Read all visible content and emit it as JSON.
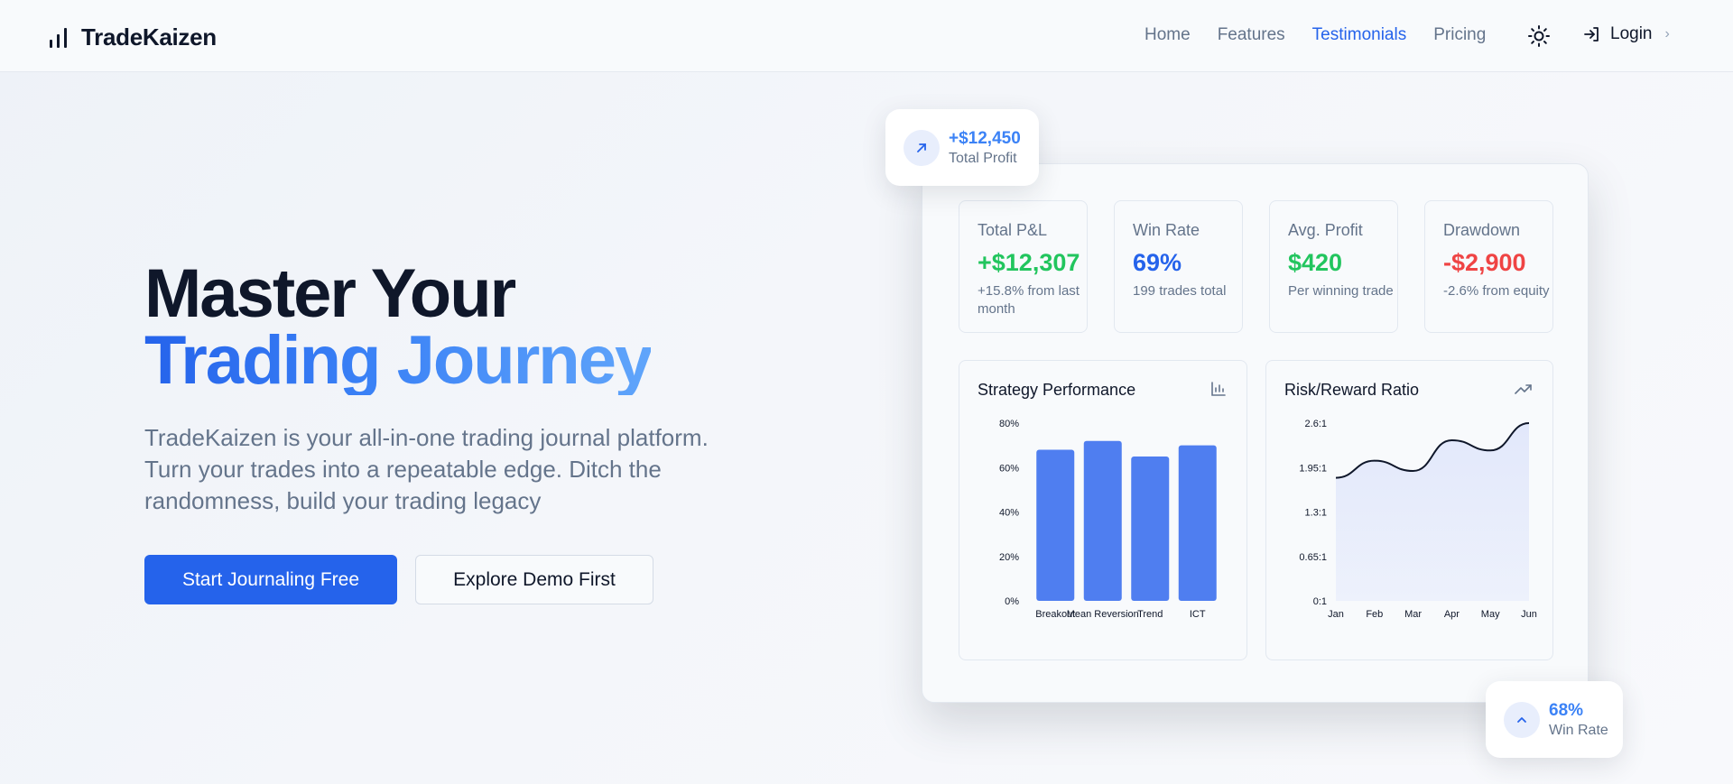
{
  "brand": {
    "name": "TradeKaizen"
  },
  "nav": {
    "items": [
      {
        "label": "Home"
      },
      {
        "label": "Features"
      },
      {
        "label": "Testimonials"
      },
      {
        "label": "Pricing"
      }
    ],
    "active": "Testimonials",
    "login_label": "Login"
  },
  "hero": {
    "title_line1": "Master Your",
    "title_line2": "Trading Journey",
    "subtitle": "TradeKaizen is your all-in-one trading journal platform. Turn your trades into a repeatable edge. Ditch the randomness, build your trading legacy",
    "primary_button": "Start Journaling Free",
    "secondary_button": "Explore Demo First"
  },
  "badges": {
    "profit": {
      "value": "+$12,450",
      "label": "Total Profit"
    },
    "winrate": {
      "value": "68%",
      "label": "Win Rate"
    }
  },
  "stats": [
    {
      "label": "Total P&L",
      "value": "+$12,307",
      "sub": "+15.8% from last month",
      "color": "#22c55e"
    },
    {
      "label": "Win Rate",
      "value": "69%",
      "sub": "199 trades total",
      "color": "#2563eb"
    },
    {
      "label": "Avg. Profit",
      "value": "$420",
      "sub": "Per winning trade",
      "color": "#22c55e"
    },
    {
      "label": "Drawdown",
      "value": "-$2,900",
      "sub": "-2.6% from equity",
      "color": "#ef4444"
    }
  ],
  "chart_data": [
    {
      "type": "bar",
      "title": "Strategy Performance",
      "categories": [
        "Breakout",
        "Mean Reversion",
        "Trend",
        "ICT"
      ],
      "values": [
        68,
        72,
        65,
        70
      ],
      "ylim": [
        0,
        80
      ],
      "yticks": [
        "0%",
        "20%",
        "40%",
        "60%",
        "80%"
      ],
      "grid": false,
      "color": "#4f7ef0"
    },
    {
      "type": "area",
      "title": "Risk/Reward Ratio",
      "categories": [
        "Jan",
        "Feb",
        "Mar",
        "Apr",
        "May",
        "Jun"
      ],
      "values": [
        1.8,
        2.05,
        1.9,
        2.35,
        2.2,
        2.6
      ],
      "ylim": [
        0,
        2.6
      ],
      "yticks": [
        "0:1",
        "0.65:1",
        "1.3:1",
        "1.95:1",
        "2.6:1"
      ],
      "grid": false,
      "line_color": "#0f172a",
      "fill_color": "#e2e8fb"
    }
  ]
}
